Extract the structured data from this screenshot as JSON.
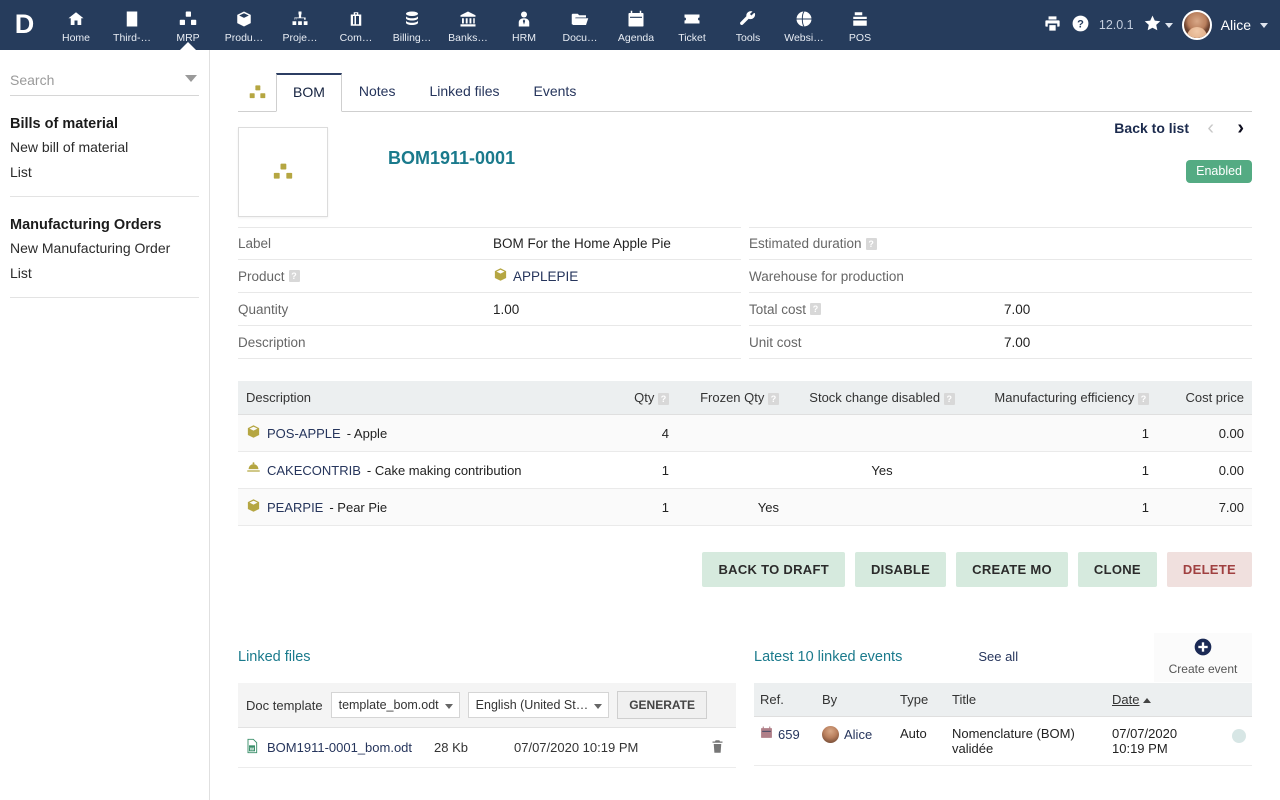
{
  "app": {
    "logo_letter": "D",
    "version": "12.0.1"
  },
  "topnav": {
    "items": [
      {
        "label": "Home",
        "icon": "home-icon"
      },
      {
        "label": "Third-…",
        "icon": "building-icon"
      },
      {
        "label": "MRP",
        "icon": "cubes-icon",
        "active": true
      },
      {
        "label": "Produ…",
        "icon": "box-icon"
      },
      {
        "label": "Proje…",
        "icon": "sitemap-icon"
      },
      {
        "label": "Com…",
        "icon": "briefcase-icon"
      },
      {
        "label": "Billing…",
        "icon": "coins-icon"
      },
      {
        "label": "Banks…",
        "icon": "bank-icon"
      },
      {
        "label": "HRM",
        "icon": "user-tie-icon"
      },
      {
        "label": "Docu…",
        "icon": "folder-open-icon"
      },
      {
        "label": "Agenda",
        "icon": "calendar-icon"
      },
      {
        "label": "Ticket",
        "icon": "ticket-icon"
      },
      {
        "label": "Tools",
        "icon": "wrench-icon"
      },
      {
        "label": "Websi…",
        "icon": "globe-icon"
      },
      {
        "label": "POS",
        "icon": "cash-register-icon"
      }
    ],
    "print_icon": "printer-icon",
    "help_icon": "question-circle-icon",
    "bookmark_icon": "star-icon",
    "user_name": "Alice"
  },
  "sidebar": {
    "search_placeholder": "Search",
    "search_value": "",
    "groups": [
      {
        "title": "Bills of material",
        "links": [
          "New bill of material",
          "List"
        ]
      },
      {
        "title": "Manufacturing Orders",
        "links": [
          "New Manufacturing Order",
          "List"
        ]
      }
    ]
  },
  "tabs": {
    "icon": "cubes-icon",
    "items": [
      {
        "label": "BOM",
        "active": true
      },
      {
        "label": "Notes",
        "active": false
      },
      {
        "label": "Linked files",
        "active": false
      },
      {
        "label": "Events",
        "active": false
      }
    ]
  },
  "record": {
    "thumb_icon": "cubes-icon",
    "ref": "BOM1911-0001",
    "back_to_list": "Back to list",
    "prev_icon": "chevron-left-icon",
    "next_icon": "chevron-right-icon",
    "status": "Enabled",
    "status_color": "#54ab83"
  },
  "details": {
    "left": [
      {
        "label": "Label",
        "help": false,
        "value": "BOM For the Home Apple Pie",
        "type": "text"
      },
      {
        "label": "Product",
        "help": true,
        "value": "APPLEPIE",
        "type": "link-product"
      },
      {
        "label": "Quantity",
        "help": false,
        "value": "1.00",
        "type": "text"
      },
      {
        "label": "Description",
        "help": false,
        "value": "",
        "type": "text"
      }
    ],
    "right": [
      {
        "label": "Estimated duration",
        "help": true,
        "value": "",
        "type": "text"
      },
      {
        "label": "Warehouse for production",
        "help": false,
        "value": "",
        "type": "text"
      },
      {
        "label": "Total cost",
        "help": true,
        "value": "7.00",
        "type": "text"
      },
      {
        "label": "Unit cost",
        "help": false,
        "value": "7.00",
        "type": "text"
      }
    ]
  },
  "lines_table": {
    "columns": [
      {
        "label": "Description",
        "help": false
      },
      {
        "label": "Qty",
        "help": true
      },
      {
        "label": "Frozen Qty",
        "help": true
      },
      {
        "label": "Stock change disabled",
        "help": true
      },
      {
        "label": "Manufacturing efficiency",
        "help": true
      },
      {
        "label": "Cost price",
        "help": false
      }
    ],
    "rows": [
      {
        "icon": "box-icon",
        "code": "POS-APPLE",
        "name": " - Apple",
        "qty": "4",
        "frozen_qty": "",
        "stock_change_disabled": "",
        "efficiency": "1",
        "cost_price": "0.00"
      },
      {
        "icon": "service-bell-icon",
        "code": "CAKECONTRIB",
        "name": " - Cake making contribution",
        "qty": "1",
        "frozen_qty": "",
        "stock_change_disabled": "Yes",
        "efficiency": "1",
        "cost_price": "0.00"
      },
      {
        "icon": "box-icon",
        "code": "PEARPIE",
        "name": " - Pear Pie",
        "qty": "1",
        "frozen_qty": "Yes",
        "stock_change_disabled": "",
        "efficiency": "1",
        "cost_price": "7.00"
      }
    ]
  },
  "actions": [
    {
      "label": "BACK TO DRAFT",
      "style": "normal"
    },
    {
      "label": "DISABLE",
      "style": "normal"
    },
    {
      "label": "CREATE MO",
      "style": "normal"
    },
    {
      "label": "CLONE",
      "style": "normal"
    },
    {
      "label": "DELETE",
      "style": "danger"
    }
  ],
  "linked_files": {
    "title": "Linked files",
    "doc_template_label": "Doc template",
    "template_value": "template_bom.odt",
    "language_value": "English (United St…",
    "generate_label": "GENERATE",
    "files": [
      {
        "icon": "word-doc-icon",
        "name": "BOM1911-0001_bom.odt",
        "size": "28 Kb",
        "date": "07/07/2020 10:19 PM",
        "delete_icon": "trash-icon"
      }
    ]
  },
  "events": {
    "title": "Latest 10 linked events",
    "see_all": "See all",
    "create_event_label": "Create event",
    "create_event_icon": "plus-circle-icon",
    "columns": [
      "Ref.",
      "By",
      "Type",
      "Title",
      "Date"
    ],
    "sorted_column": "Date",
    "sort_direction": "asc",
    "rows": [
      {
        "ref_icon": "calendar-icon",
        "ref": "659",
        "by": "Alice",
        "type": "Auto",
        "title": "Nomenclature (BOM) validée",
        "date_line1": "07/07/2020",
        "date_line2": "10:19 PM",
        "indicator": "status-dot"
      }
    ]
  }
}
